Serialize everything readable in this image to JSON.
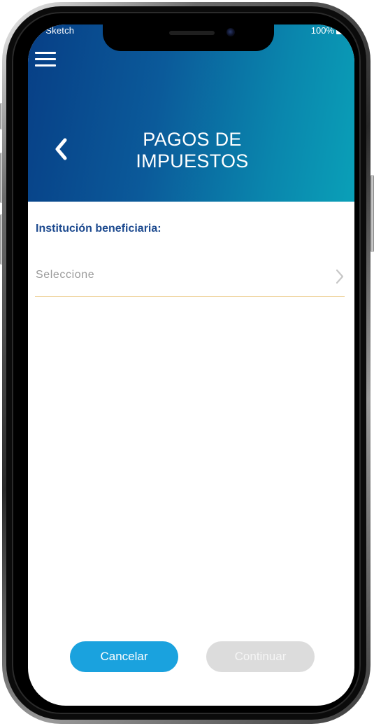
{
  "status_bar": {
    "carrier": "Sketch",
    "signal_dots": "●●",
    "battery": "100%"
  },
  "header": {
    "menu_icon": "hamburger-menu-icon",
    "back_icon": "chevron-left-icon",
    "title_line1": "PAGOS DE",
    "title_line2": "IMPUESTOS"
  },
  "form": {
    "institution_label": "Institución beneficiaria:",
    "institution_placeholder": "Seleccione",
    "chevron_icon": "chevron-right-icon"
  },
  "actions": {
    "cancel_label": "Cancelar",
    "continue_label": "Continuar",
    "continue_enabled": false
  },
  "colors": {
    "header_start": "#073f86",
    "header_end": "#0aa0b8",
    "label": "#1d4a8f",
    "cancel_button": "#1aa2de",
    "continue_button_disabled": "#dcdcdc",
    "select_underline": "#f1d8a8"
  }
}
